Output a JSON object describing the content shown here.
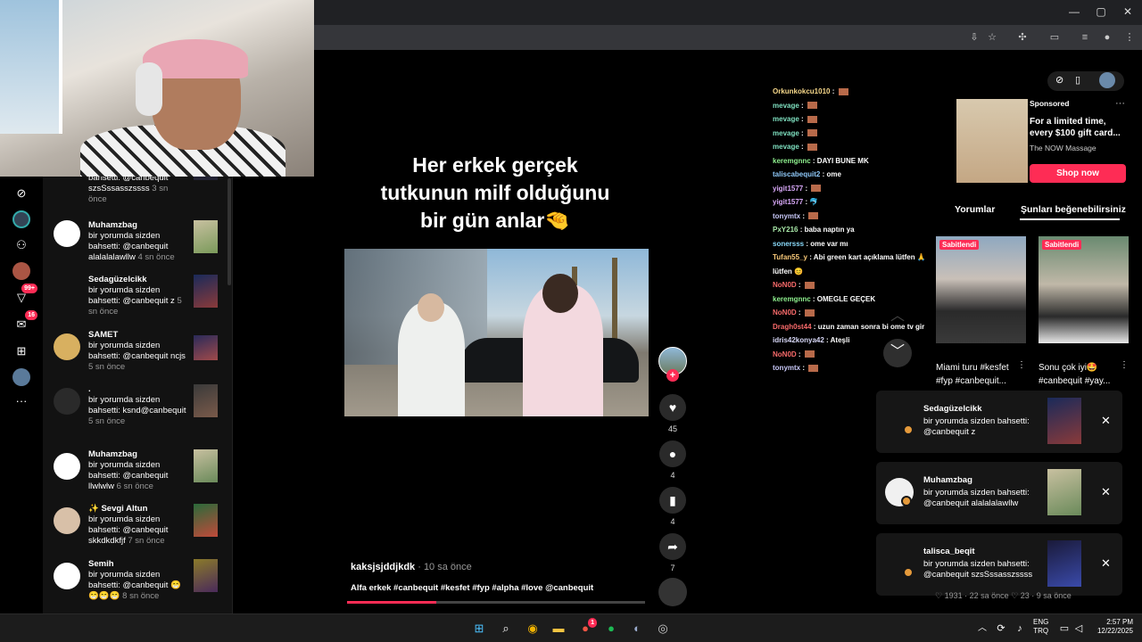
{
  "browser": {
    "minimize": "—",
    "maximize": "▢",
    "close": "✕"
  },
  "leftnav": {
    "badge_inbox": "99+",
    "badge_msgs": "16"
  },
  "notifications": [
    {
      "text": "bahsetti: @canbequit szsSssasszssss",
      "time": "3 sn önce",
      "name": ""
    },
    {
      "name": "Muhamzbag",
      "text": "bir yorumda sizden bahsetti: @canbequit alalalalawllw",
      "time": "4 sn önce"
    },
    {
      "name": "Sedagüzelcikk",
      "text": "bir yorumda sizden bahsetti: @canbequit z",
      "time": "5 sn önce"
    },
    {
      "name": "SAMET",
      "text": "bir yorumda sizden bahsetti: @canbequit ncjs",
      "time": "5 sn önce"
    },
    {
      "name": ".",
      "text": "bir yorumda sizden bahsetti: ksnd@canbequit",
      "time": "5 sn önce"
    },
    {
      "name": "Muhamzbag",
      "text": "bir yorumda sizden bahsetti: @canbequit llwlwlw",
      "time": "6 sn önce"
    },
    {
      "name": "✨ Sevgi Altun",
      "text": "bir yorumda sizden bahsetti: @canbequit skkdkdkfjf",
      "time": "7 sn önce"
    },
    {
      "name": "Semih",
      "text": "bir yorumda sizden bahsetti: @canbequit 😁😁😁😁",
      "time": "8 sn önce"
    }
  ],
  "video": {
    "overlay_caption": "Her erkek gerçek tutkunun milf olduğunu bir gün anlar🤏",
    "author": "kaksjsjddjkdk",
    "time": "· 10 sa önce",
    "description": "Alfa erkek #canbequit #kesfet #fyp #alpha #love @canbequit",
    "progress_fraction": 0.3,
    "likes": "45",
    "comments": "4",
    "saves": "4",
    "shares": "7"
  },
  "chat": [
    {
      "user": "Orkunkokcu1010",
      "color": "#f7d88a",
      "msg": " : ",
      "emote": true
    },
    {
      "user": "mevage",
      "color": "#7fe0c0",
      "msg": " : ",
      "emote": true
    },
    {
      "user": "mevage",
      "color": "#7fe0c0",
      "msg": " : ",
      "emote": true
    },
    {
      "user": "mevage",
      "color": "#7fe0c0",
      "msg": " : ",
      "emote": true
    },
    {
      "user": "mevage",
      "color": "#7fe0c0",
      "msg": " : ",
      "emote": true
    },
    {
      "user": "keremgnnc",
      "color": "#8ef08e",
      "msg": " : DAYI BUNE MK",
      "emote": false
    },
    {
      "user": "taliscabequit2",
      "color": "#8ec8f8",
      "msg": " : ome",
      "emote": false
    },
    {
      "user": "yigit1577",
      "color": "#d8a8f8",
      "msg": " : ",
      "emote": true
    },
    {
      "user": "yigit1577",
      "color": "#d8a8f8",
      "msg": " : 🐬",
      "emote": false
    },
    {
      "user": "tonymtx",
      "color": "#c8c8f8",
      "msg": " : ",
      "emote": true
    },
    {
      "user": "PxY216",
      "color": "#a8e8a8",
      "msg": " : baba naptın ya",
      "emote": false
    },
    {
      "user": "sonersss",
      "color": "#88d8f8",
      "msg": " : ome var mı",
      "emote": false
    },
    {
      "user": "Tufan55_y",
      "color": "#f8c878",
      "msg": " : Abi green kart açıklama lütfen 🙏",
      "emote": false
    },
    {
      "user": "",
      "color": "#fff",
      "msg": "lütfen 😊",
      "emote": false
    },
    {
      "user": "NoN0D",
      "color": "#f86a6a",
      "msg": " : ",
      "emote": true
    },
    {
      "user": "keremgnnc",
      "color": "#8ef08e",
      "msg": " : OMEGLE GEÇEK",
      "emote": false
    },
    {
      "user": "NoN0D",
      "color": "#f86a6a",
      "msg": " : ",
      "emote": true
    },
    {
      "user": "Dragh0st44",
      "color": "#f86a6a",
      "msg": " : uzun zaman sonra bi ome tv gir",
      "emote": false
    },
    {
      "user": "idris42konya42",
      "color": "#d8d8f8",
      "msg": " : Ateşli",
      "emote": false
    },
    {
      "user": "NoN0D",
      "color": "#f86a6a",
      "msg": " : ",
      "emote": true
    },
    {
      "user": "tonymtx",
      "color": "#c8c8f8",
      "msg": " : ",
      "emote": true
    }
  ],
  "ad": {
    "sponsored": "Sponsored",
    "title": "For a limited time, every $100 gift card...",
    "brand": "The NOW Massage",
    "cta": "Shop now"
  },
  "sidebar_tabs": {
    "comments": "Yorumlar",
    "recommend": "Şunları beğenebilirsiniz"
  },
  "cards": [
    {
      "pin": "Sabitlendi",
      "title": "Miami turu #kesfet #fyp #canbequit..."
    },
    {
      "pin": "Sabitlendi",
      "title": "Sonu çok iyi🤩 #canbequit #yay..."
    }
  ],
  "toasts": [
    {
      "name": "Sedagüzelcikk",
      "text": "bir yorumda sizden bahsetti: @canbequit z"
    },
    {
      "name": "Muhamzbag",
      "text": "bir yorumda sizden bahsetti: @canbequit alalalalawllw"
    },
    {
      "name": "talisca_beqit",
      "text": "bir yorumda sizden bahsetti: @canbequit szsSssasszssss"
    }
  ],
  "peek_stats": "♡ 1931 · 22 sa önce      ♡ 23 · 9 sa önce",
  "taskbar": {
    "lang1": "ENG",
    "lang2": "TRQ",
    "time": "2:57 PM",
    "date": "12/22/2025",
    "browser_badge": "1"
  }
}
